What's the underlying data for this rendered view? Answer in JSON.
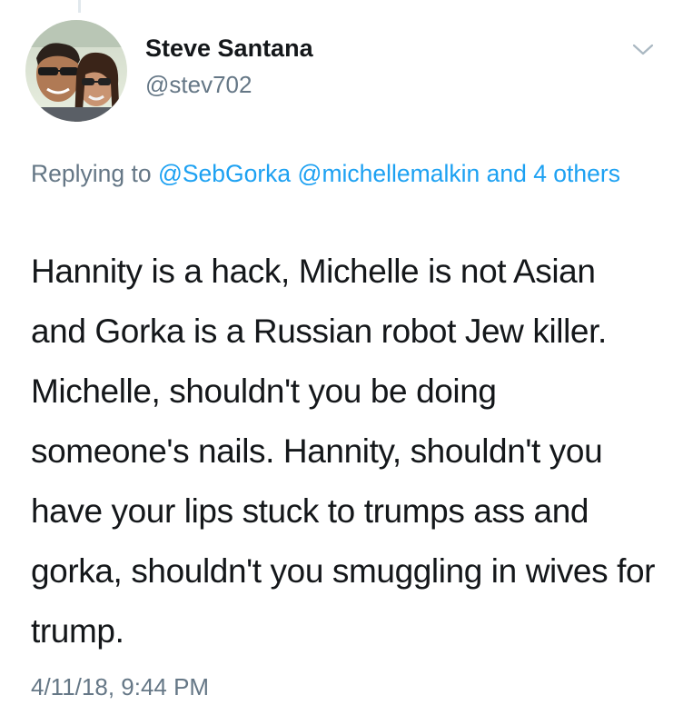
{
  "tweet": {
    "author": {
      "display_name": "Steve Santana",
      "handle": "@stev702",
      "avatar_icon": "profile-photo"
    },
    "menu_icon": "chevron-down-icon",
    "reply_context": {
      "prefix": "Replying to",
      "mention_1": "@SebGorka",
      "mention_2": "@michellemalkin",
      "conjunction": "and",
      "others": "4 others"
    },
    "text": "Hannity is a hack, Michelle is not Asian and Gorka is a Russian robot Jew killer. Michelle, shouldn't you be doing someone's nails. Hannity, shouldn't you have your lips stuck to trumps ass and gorka, shouldn't you smuggling in wives for trump.",
    "timestamp": "4/11/18, 9:44 PM"
  },
  "colors": {
    "link": "#1da1f2",
    "secondary_text": "#657786",
    "primary_text": "#14171a"
  }
}
